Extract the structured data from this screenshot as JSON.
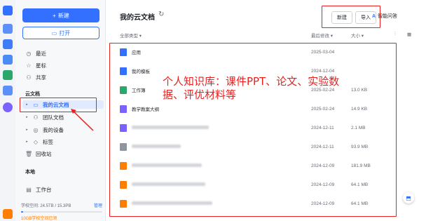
{
  "sidebar": {
    "new_label": "新建",
    "open_label": "打开",
    "items": [
      {
        "label": "最近",
        "icon": "clock-icon"
      },
      {
        "label": "星标",
        "icon": "star-icon"
      },
      {
        "label": "共享",
        "icon": "share-icon"
      }
    ],
    "section_cloud": "云文档",
    "cloud_items": [
      {
        "label": "我的云文档"
      },
      {
        "label": "团队文档"
      },
      {
        "label": "我的设备"
      },
      {
        "label": "标签"
      },
      {
        "label": "回收站"
      }
    ],
    "section_local": "本地",
    "local_items": [
      {
        "label": "工作台"
      }
    ],
    "storage_label": "学校空间:",
    "storage_value": "24.5TB / 15.3PB",
    "manage_label": "管理",
    "promo": "10GB学校空间已领"
  },
  "main": {
    "title": "我的云文档",
    "new_btn": "新建",
    "import_btn": "导入",
    "ai_btn": "智能问答",
    "col_name": "全部类型",
    "col_date": "最后修改",
    "col_size": "大小"
  },
  "files": [
    {
      "name": "应用",
      "date": "2025-03-04",
      "size": "",
      "type": "folder",
      "blur": 0
    },
    {
      "name": "我的模板",
      "date": "2024-12-04",
      "size": "",
      "type": "folder",
      "blur": 0
    },
    {
      "name": "工作簿",
      "date": "2025-02-24",
      "size": "13.0 KB",
      "type": "sheet",
      "blur": 0
    },
    {
      "name": "教学教案大纲",
      "date": "2025-02-24",
      "size": "14.9 KB",
      "type": "doc",
      "blur": 0
    },
    {
      "name": "",
      "date": "2024-12-11",
      "size": "2.1 MB",
      "type": "doc",
      "blur": 110
    },
    {
      "name": "",
      "date": "2024-12-11",
      "size": "93.9 MB",
      "type": "file",
      "blur": 70
    },
    {
      "name": "",
      "date": "2024-12-09",
      "size": "181.9 MB",
      "type": "ppt",
      "blur": 100
    },
    {
      "name": "",
      "date": "2024-12-09",
      "size": "64.1 MB",
      "type": "ppt",
      "blur": 105
    },
    {
      "name": "",
      "date": "2024-12-09",
      "size": "64.1 MB",
      "type": "ppt",
      "blur": 115
    }
  ],
  "annotation": "个人知识库：课件PPT、论文、实验数据、评优材料等",
  "colors": {
    "accent": "#3370ff",
    "annotation": "#e8211f"
  }
}
